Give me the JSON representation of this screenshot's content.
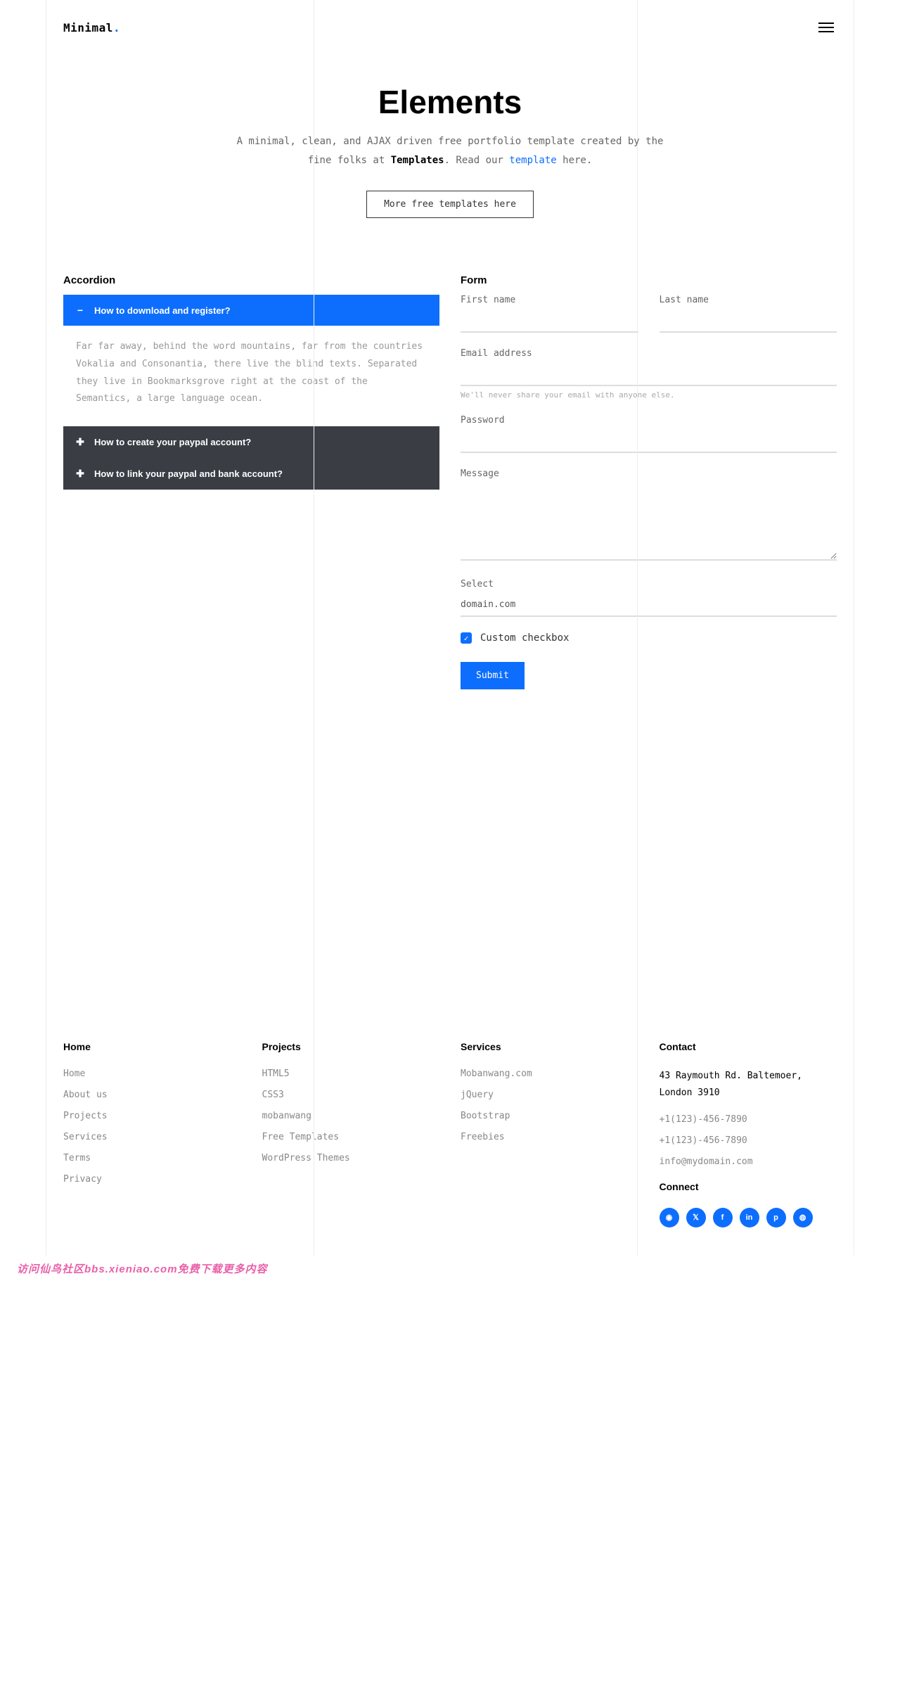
{
  "logo_main": "Minimal",
  "logo_dot": ".",
  "hero": {
    "title": "Elements",
    "intro_1": "A minimal, clean, and AJAX driven free portfolio template created by the fine folks at ",
    "intro_bold": "Templates",
    "intro_2": ". Read our ",
    "intro_link": "template",
    "intro_3": " here.",
    "button": "More free templates here"
  },
  "accordion": {
    "title": "Accordion",
    "items": [
      {
        "q": "How to download and register?",
        "open": true,
        "a": "Far far away, behind the word mountains, far from the countries Vokalia and Consonantia, there live the blind texts. Separated they live in Bookmarksgrove right at the coast of the Semantics, a large language ocean."
      },
      {
        "q": "How to create your paypal account?",
        "open": false
      },
      {
        "q": "How to link your paypal and bank account?",
        "open": false
      }
    ]
  },
  "form": {
    "title": "Form",
    "first_name": "First name",
    "last_name": "Last name",
    "email_label": "Email address",
    "email_hint": "We'll never share your email with anyone else.",
    "password_label": "Password",
    "message_label": "Message",
    "select_label": "Select",
    "select_value": "domain.com",
    "checkbox_label": "Custom checkbox",
    "submit": "Submit"
  },
  "footer": {
    "home": {
      "title": "Home",
      "links": [
        "Home",
        "About us",
        "Projects",
        "Services",
        "Terms",
        "Privacy"
      ]
    },
    "projects": {
      "title": "Projects",
      "links": [
        "HTML5",
        "CSS3",
        "mobanwang",
        "Free Templates",
        "WordPress Themes"
      ]
    },
    "services": {
      "title": "Services",
      "links": [
        "Mobanwang.com",
        "jQuery",
        "Bootstrap",
        "Freebies"
      ]
    },
    "contact": {
      "title": "Contact",
      "address": "43 Raymouth Rd. Baltemoer, London 3910",
      "phone1": "+1(123)-456-7890",
      "phone2": "+1(123)-456-7890",
      "email": "info@mydomain.com",
      "connect": "Connect",
      "socials": [
        "ig",
        "tw",
        "fb",
        "in",
        "pi",
        "dr"
      ]
    }
  },
  "watermark": "访问仙鸟社区bbs.xieniao.com免费下载更多内容"
}
